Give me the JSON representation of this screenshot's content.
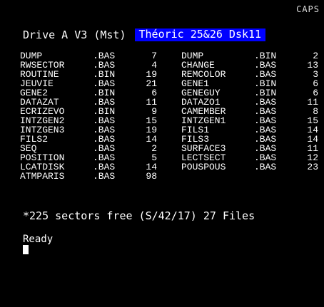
{
  "header": {
    "caps_indicator": "CAPS"
  },
  "drive": {
    "label": "Drive A V3 (Mst)",
    "disk_title": "Théoric 25&26 Dsk11"
  },
  "files_left": [
    {
      "name": "DUMP",
      "ext": ".BAS",
      "size": "7"
    },
    {
      "name": "RWSECTOR",
      "ext": ".BAS",
      "size": "4"
    },
    {
      "name": "ROUTINE",
      "ext": ".BIN",
      "size": "19"
    },
    {
      "name": "JEUVIE",
      "ext": ".BAS",
      "size": "21"
    },
    {
      "name": "GENE2",
      "ext": ".BIN",
      "size": "6"
    },
    {
      "name": "DATAZAT",
      "ext": ".BAS",
      "size": "11"
    },
    {
      "name": "ECRIZEVO",
      "ext": ".BIN",
      "size": "9"
    },
    {
      "name": "INTZGEN2",
      "ext": ".BAS",
      "size": "15"
    },
    {
      "name": "INTZGEN3",
      "ext": ".BAS",
      "size": "19"
    },
    {
      "name": "FILS2",
      "ext": ".BAS",
      "size": "14"
    },
    {
      "name": "SEQ",
      "ext": ".BAS",
      "size": "2"
    },
    {
      "name": "POSITION",
      "ext": ".BAS",
      "size": "5"
    },
    {
      "name": "LCATDISK",
      "ext": ".BAS",
      "size": "14"
    },
    {
      "name": "ATMPARIS",
      "ext": ".BAS",
      "size": "98"
    }
  ],
  "files_right": [
    {
      "name": "DUMP",
      "ext": ".BIN",
      "size": "2"
    },
    {
      "name": "CHANGE",
      "ext": ".BAS",
      "size": "13"
    },
    {
      "name": "REMCOLOR",
      "ext": ".BAS",
      "size": "3"
    },
    {
      "name": "GENE1",
      "ext": ".BIN",
      "size": "6"
    },
    {
      "name": "GENEGUY",
      "ext": ".BIN",
      "size": "6"
    },
    {
      "name": "DATAZO1",
      "ext": ".BAS",
      "size": "11"
    },
    {
      "name": "CAMEMBER",
      "ext": ".BAS",
      "size": "8"
    },
    {
      "name": "INTZGEN1",
      "ext": ".BAS",
      "size": "15"
    },
    {
      "name": "FILS1",
      "ext": ".BAS",
      "size": "14"
    },
    {
      "name": "FILS3",
      "ext": ".BAS",
      "size": "14"
    },
    {
      "name": "SURFACE3",
      "ext": ".BAS",
      "size": "11"
    },
    {
      "name": "LECTSECT",
      "ext": ".BAS",
      "size": "12"
    },
    {
      "name": "POUSPOUS",
      "ext": ".BAS",
      "size": "23"
    }
  ],
  "status": {
    "free_summary": "*225 sectors free (S/42/17) 27 Files",
    "ready": "Ready"
  },
  "colors": {
    "background": "#000000",
    "text": "#ffffff",
    "title_highlight": "#0000ff"
  }
}
